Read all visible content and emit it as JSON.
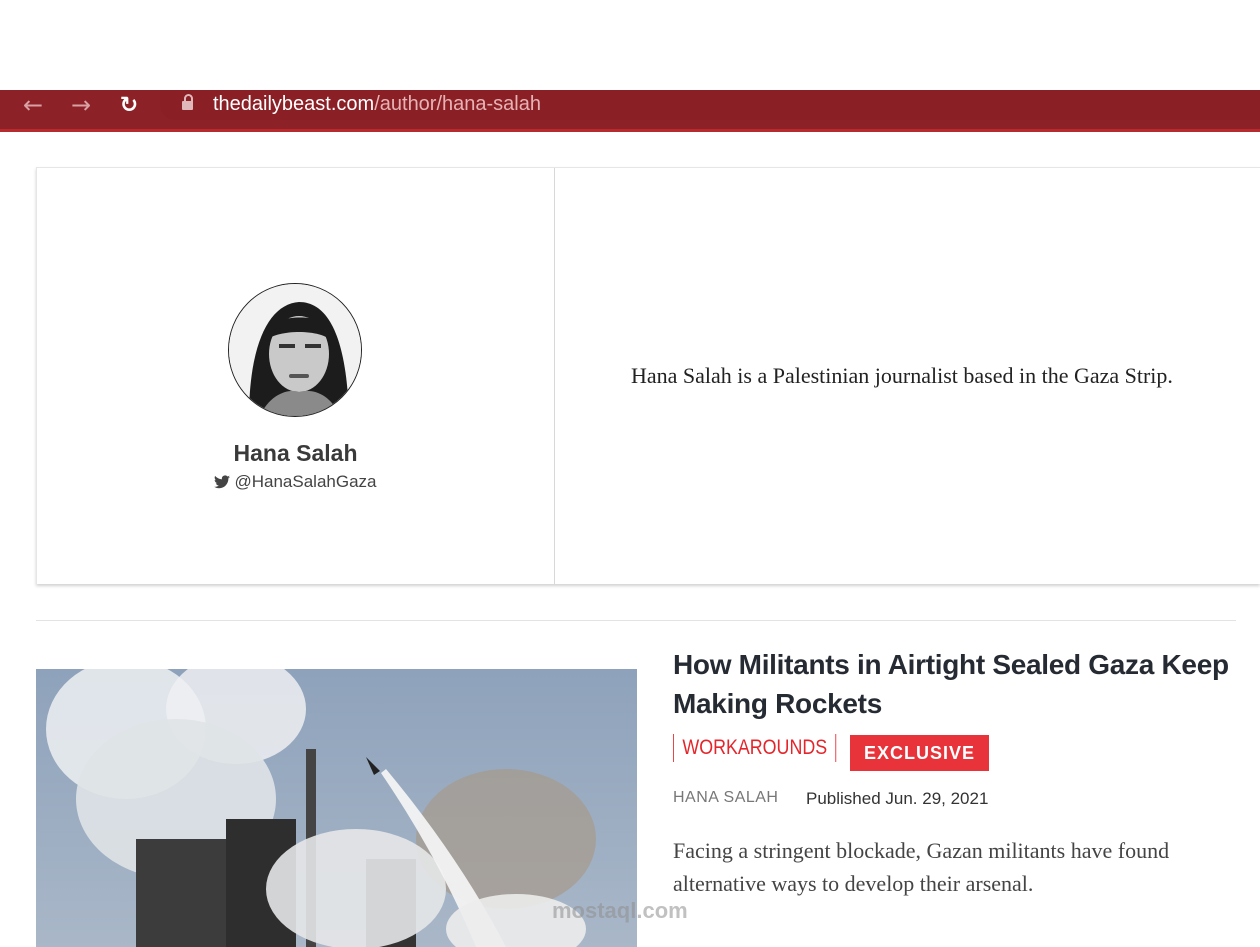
{
  "browser": {
    "url_domain": "thedailybeast.com",
    "url_path": "/author/hana-salah",
    "icons": {
      "back": "arrow-left-icon",
      "forward": "arrow-right-icon",
      "reload": "reload-icon",
      "lock": "lock-icon"
    }
  },
  "author": {
    "name": "Hana Salah",
    "twitter_handle": "@HanaSalahGaza",
    "bio": "Hana Salah is a Palestinian journalist based in the Gaza Strip."
  },
  "article": {
    "title": "How Militants in Airtight Sealed Gaza Keep Making Rockets",
    "section": "WORKAROUNDS",
    "badge": "EXCLUSIVE",
    "byline": "HANA SALAH",
    "published": "Published Jun. 29, 2021",
    "teaser": "Facing a stringent blockade, Gazan militants have found alternative ways to develop their arsenal."
  },
  "watermark": {
    "text": "mostaql.com"
  },
  "colors": {
    "brand_red": "#e4262c",
    "toolbar": "#8c2127",
    "badge_bg": "#e8333a"
  }
}
